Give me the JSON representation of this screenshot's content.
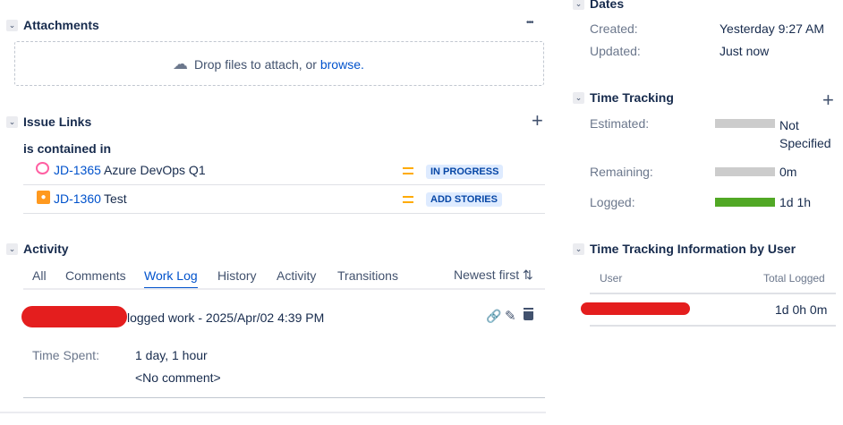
{
  "attachments": {
    "title": "Attachments",
    "more": "•••",
    "drop_text": "Drop files to attach, or ",
    "browse": "browse."
  },
  "issue_links": {
    "title": "Issue Links",
    "add": "+",
    "relation": "is contained in",
    "items": [
      {
        "key": "JD-1365",
        "summary": "Azure DevOps Q1",
        "status": "IN PROGRESS",
        "icon": "epic-icon",
        "color": "#ff5fa2"
      },
      {
        "key": "JD-1360",
        "summary": "Test",
        "status": "ADD STORIES",
        "icon": "idea-icon",
        "color": "#ff991f"
      }
    ]
  },
  "activity": {
    "title": "Activity",
    "tabs": [
      "All",
      "Comments",
      "Work Log",
      "History",
      "Activity",
      "Transitions"
    ],
    "active_tab": "Work Log",
    "sort": "Newest first",
    "worklog": {
      "action": "logged work - 2025/Apr/02 4:39 PM",
      "time_spent_label": "Time Spent:",
      "time_spent": "1 day, 1 hour",
      "comment": "<No comment>"
    }
  },
  "dates": {
    "title": "Dates",
    "created_label": "Created:",
    "created": "Yesterday 9:27 AM",
    "updated_label": "Updated:",
    "updated": "Just now"
  },
  "time_tracking": {
    "title": "Time Tracking",
    "add": "+",
    "estimated_label": "Estimated:",
    "estimated": "Not Specified",
    "remaining_label": "Remaining:",
    "remaining": "0m",
    "logged_label": "Logged:",
    "logged": "1d 1h",
    "logged_fraction": 1.0,
    "colors": {
      "empty": "#cccccc",
      "logged": "#51a825"
    }
  },
  "by_user": {
    "title": "Time Tracking Information by User",
    "col_user": "User",
    "col_total": "Total Logged",
    "rows": [
      {
        "total": "1d 0h 0m"
      }
    ]
  }
}
